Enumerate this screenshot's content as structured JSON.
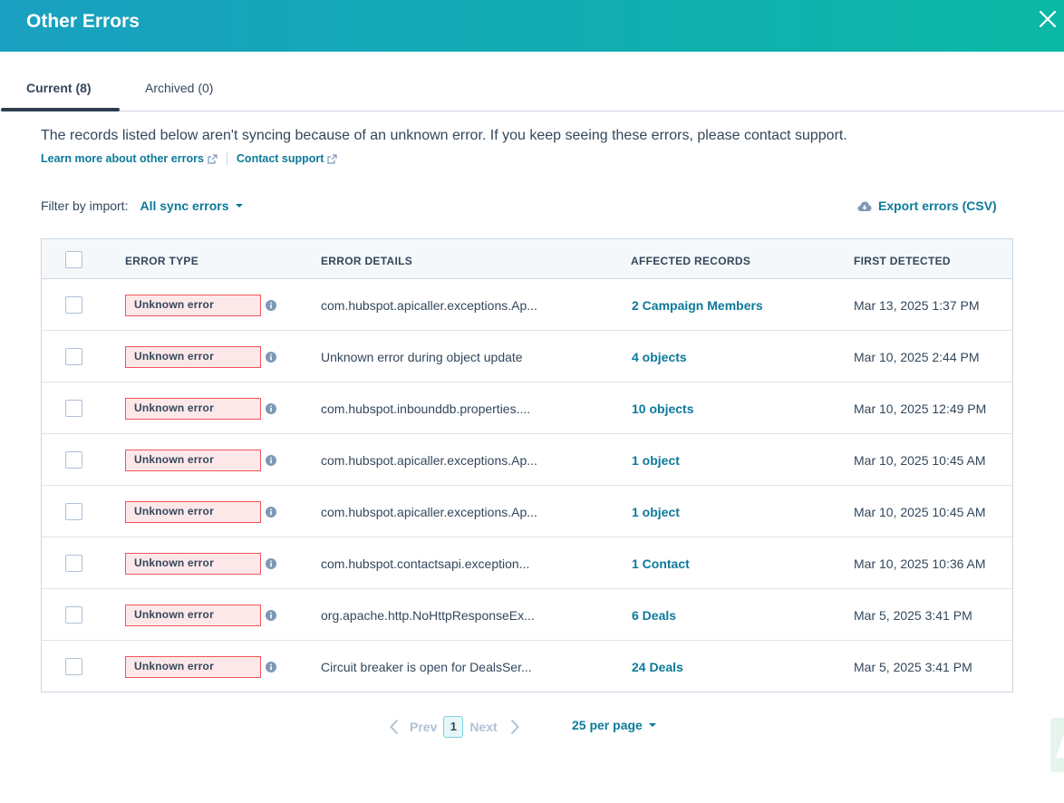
{
  "header": {
    "title": "Other Errors"
  },
  "tabs": {
    "current": "Current (8)",
    "archived": "Archived (0)"
  },
  "description": "The records listed below aren't syncing because of an unknown error. If you keep seeing these errors, please contact support.",
  "links": {
    "learn_more": "Learn more about other errors",
    "contact": "Contact support"
  },
  "filter": {
    "label": "Filter by import:",
    "value": "All sync errors"
  },
  "export_label": "Export errors (CSV)",
  "table": {
    "headers": {
      "error_type": "ERROR TYPE",
      "error_details": "ERROR DETAILS",
      "affected_records": "AFFECTED RECORDS",
      "first_detected": "FIRST DETECTED"
    },
    "rows": [
      {
        "type": "Unknown error",
        "details": "com.hubspot.apicaller.exceptions.Ap...",
        "affected": "2 Campaign Members",
        "detected": "Mar 13, 2025 1:37 PM"
      },
      {
        "type": "Unknown error",
        "details": "Unknown error during object update",
        "affected": "4 objects",
        "detected": "Mar 10, 2025 2:44 PM"
      },
      {
        "type": "Unknown error",
        "details": "com.hubspot.inbounddb.properties....",
        "affected": "10 objects",
        "detected": "Mar 10, 2025 12:49 PM"
      },
      {
        "type": "Unknown error",
        "details": "com.hubspot.apicaller.exceptions.Ap...",
        "affected": "1 object",
        "detected": "Mar 10, 2025 10:45 AM"
      },
      {
        "type": "Unknown error",
        "details": "com.hubspot.apicaller.exceptions.Ap...",
        "affected": "1 object",
        "detected": "Mar 10, 2025 10:45 AM"
      },
      {
        "type": "Unknown error",
        "details": "com.hubspot.contactsapi.exception...",
        "affected": "1 Contact",
        "detected": "Mar 10, 2025 10:36 AM"
      },
      {
        "type": "Unknown error",
        "details": "org.apache.http.NoHttpResponseEx...",
        "affected": "6 Deals",
        "detected": "Mar 5, 2025 3:41 PM"
      },
      {
        "type": "Unknown error",
        "details": "Circuit breaker is open for DealsSer...",
        "affected": "24 Deals",
        "detected": "Mar 5, 2025 3:41 PM"
      }
    ]
  },
  "pagination": {
    "prev": "Prev",
    "current_page": "1",
    "next": "Next",
    "per_page": "25 per page"
  },
  "colors": {
    "header_start": "#1aa0c1",
    "header_end": "#0bb8a5",
    "link": "#0b7a9a",
    "error_border": "#f2545b",
    "error_bg": "#fde8e9"
  },
  "icons": [
    "close-icon",
    "external-link-icon",
    "cloud-download-icon",
    "info-icon",
    "chevron-left-icon",
    "chevron-right-icon",
    "caret-down-icon"
  ]
}
